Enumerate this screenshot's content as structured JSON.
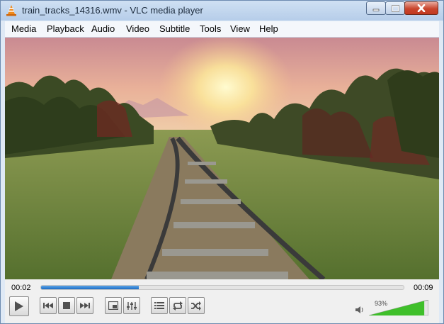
{
  "window": {
    "title": "train_tracks_14316.wmv - VLC media player"
  },
  "menu": {
    "items": [
      "Media",
      "Playback",
      "Audio",
      "Video",
      "Subtitle",
      "Tools",
      "View",
      "Help"
    ]
  },
  "playback": {
    "elapsed": "00:02",
    "remaining": "00:09",
    "progress_fraction": 0.27
  },
  "volume": {
    "label": "93%",
    "level_fraction": 0.93
  },
  "icons": {
    "app": "vlc-cone-icon",
    "minimize": "minimize-icon",
    "maximize": "maximize-icon",
    "close": "close-icon",
    "play": "play-icon",
    "previous": "previous-icon",
    "stop": "stop-icon",
    "next": "next-icon",
    "fullscreen": "fullscreen-icon",
    "extended": "equalizer-icon",
    "playlist": "playlist-icon",
    "loop": "loop-icon",
    "shuffle": "shuffle-icon",
    "speaker": "speaker-icon"
  },
  "colors": {
    "seek_fill": "#1d6cc4",
    "volume_fill": "#3fbf2a",
    "close_button": "#c9452d"
  }
}
